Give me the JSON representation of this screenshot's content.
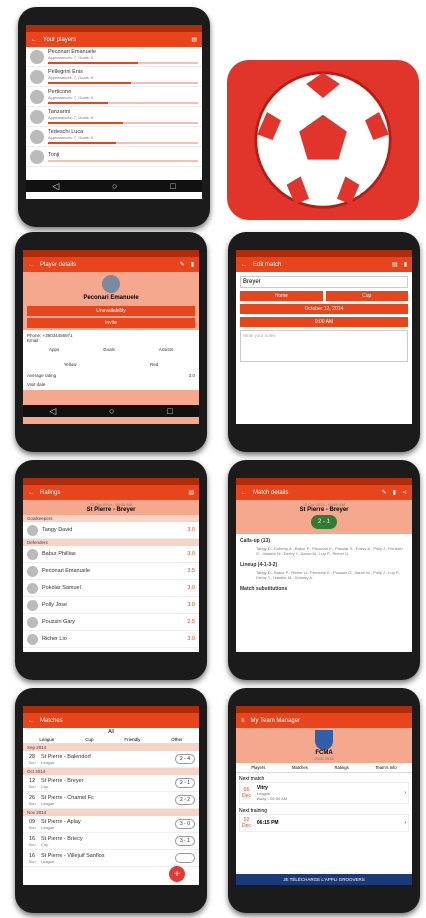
{
  "colors": {
    "primary": "#e9451c",
    "dark": "#b22a08",
    "salmon": "#f5a88e"
  },
  "icons": {
    "back": "arrow-left-icon",
    "edit": "pencil-icon",
    "del": "trash-icon",
    "share": "share-icon",
    "save": "save-icon",
    "ball": "soccer-ball-icon"
  },
  "players": {
    "title": "Your players",
    "items": [
      {
        "name": "Peconari Emanuele",
        "sub": "Appearances: 7, Goals: 0",
        "rating": 0.6
      },
      {
        "name": "Pellegrini Enis",
        "sub": "Appearances: 7, Goals: 0",
        "rating": 0.55
      },
      {
        "name": "Perticone",
        "sub": "Appearances: 7, Goals: 0",
        "rating": 0.4
      },
      {
        "name": "Tanzarini",
        "sub": "Appearances: 7, Goals: 0",
        "rating": 0.5
      },
      {
        "name": "Tedeschi Luca",
        "sub": "Appearances: 7, Goals: 0",
        "rating": 0.45
      },
      {
        "name": "Tonji",
        "sub": "",
        "rating": 0
      }
    ]
  },
  "player": {
    "title": "Player details",
    "name": "Peconari Emanuele",
    "b1": "Unavailability",
    "b2": "Invite",
    "phone": "Phone: +39034456971",
    "email": "Email",
    "stats": [
      "Apps",
      "Goals",
      "Assists"
    ],
    "cards": [
      "Yellow",
      "Red"
    ],
    "avg_label": "Average rating",
    "avg_value": "3.0",
    "visit": "Visit date"
  },
  "edit": {
    "title": "Edit match",
    "opponent": "Breyer",
    "home": "Home",
    "type": "Cup",
    "date": "October 12, 2014",
    "time": "9:00 AM",
    "notes": "Write your notes"
  },
  "ratings": {
    "title": "Ratings",
    "date": "12 Oct 2014 - 09:00 AM",
    "match": "St Pierre - Breyer",
    "sections": [
      "Goalkeepers",
      "Defenders"
    ],
    "items": [
      {
        "name": "Tangy David",
        "v": "3.0",
        "sec": 0
      },
      {
        "name": "Babur Phillias",
        "v": "3.0",
        "sec": 1
      },
      {
        "name": "Peconari Emanuele",
        "v": "3.5"
      },
      {
        "name": "Pokolar Samuel",
        "v": "3.0"
      },
      {
        "name": "Polly Jose",
        "v": "3.0"
      },
      {
        "name": "Poussin Gary",
        "v": "2.5"
      },
      {
        "name": "Richer Lio",
        "v": "3.0"
      }
    ]
  },
  "details": {
    "title": "Match details",
    "date": "12 Oct 2014 - 09:00 AM",
    "match": "St Pierre - Breyer",
    "score": "2 - 1",
    "callup": "Calls-up (13)",
    "callup_text": "Tangy D., Doherty A., Babur P., Peconari E., Pokolar S., Fussy A., Polly J., Poussin G., Hassler M., Derby Y., Aaron M., Lup P., Richer U.",
    "lineup": "Lineup (4-1-3-2)",
    "lineup_text": "Tangy D., Babur P., Richer U., Peconari E., Poussin G., Aaron M., Polly J., Lup P., Derby Y., Hassler M., Doherty A.",
    "subs": "Match substitutions"
  },
  "matches": {
    "title": "Matches",
    "filter": "All",
    "cols": [
      "League",
      "Cup",
      "Friendly",
      "Other"
    ],
    "groups": [
      {
        "month": "Sep 2014",
        "rows": [
          {
            "d": "28",
            "dw": "Sun",
            "m": "St Pierre - Balendorf",
            "t": "League",
            "s": "2 - 4"
          }
        ]
      },
      {
        "month": "Oct 2014",
        "rows": [
          {
            "d": "12",
            "dw": "Sun",
            "m": "St Pierre - Breyer",
            "t": "Cup",
            "s": "2 - 1"
          },
          {
            "d": "26",
            "dw": "Sun",
            "m": "St Pierre - Chamel Fc",
            "t": "League",
            "s": "2 - 2"
          }
        ]
      },
      {
        "month": "Nov 2014",
        "rows": [
          {
            "d": "09",
            "dw": "Sun",
            "m": "St Pierre - Aplay",
            "t": "League",
            "s": "3 - 0"
          },
          {
            "d": "16",
            "dw": "Sun",
            "m": "St Pierre - Briecy",
            "t": "Cup",
            "s": "3 - 1"
          },
          {
            "d": "16",
            "dw": "Sun",
            "m": "St Pierre - Villejuif Sanflos",
            "t": "League",
            "s": ""
          }
        ]
      }
    ]
  },
  "team": {
    "title": "My Team Manager",
    "club": "FCMA",
    "season": "2015-2016",
    "tabs": [
      "Players",
      "Matches",
      "Ratings",
      "Team's Info"
    ],
    "next_match": "Next match",
    "nm_day": "06",
    "nm_mon": "Dec",
    "nm_team": "Vitry",
    "nm_type": "League",
    "nm_time": "Away - 06:30 AM",
    "next_training": "Next training",
    "nt_day": "02",
    "nt_mon": "Dec",
    "nt_time": "06:15 PM",
    "banner": "JE TÉLÉCHARGE L'APPLI GROOVERS"
  }
}
